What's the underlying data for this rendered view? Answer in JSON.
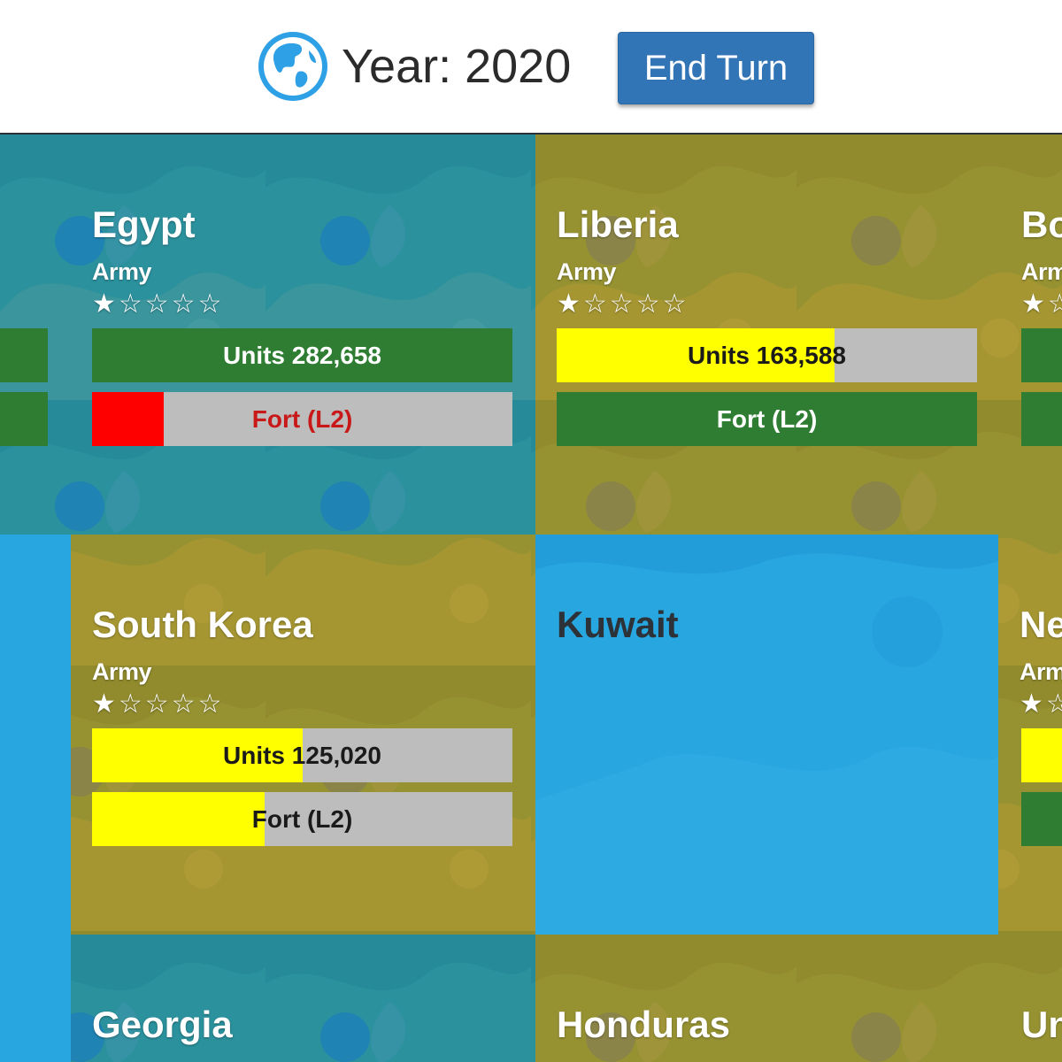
{
  "header": {
    "year_label": "Year: 2020",
    "end_turn_label": "End Turn",
    "icon": "globe-icon"
  },
  "colors": {
    "ocean_blue": "#1a8ad6",
    "land_orange": "#d68c12",
    "kuwait_blue": "#27a6e0",
    "bar_green": "#2e7d32",
    "bar_yellow": "#ffff00",
    "bar_red": "#ff0000",
    "bar_track": "#bdbdbd",
    "button_blue": "#3275b7"
  },
  "tiles": {
    "egypt": {
      "name": "Egypt",
      "army_label": "Army",
      "stars": "★☆☆☆☆",
      "units_label": "Units 282,658",
      "units_fill": 1.0,
      "fort_label": "Fort (L2)",
      "fort_fill": 0.17
    },
    "liberia": {
      "name": "Liberia",
      "army_label": "Army",
      "stars": "★☆☆☆☆",
      "units_label": "Units 163,588",
      "units_fill": 0.66,
      "fort_label": "Fort (L2)",
      "fort_fill": 1.0
    },
    "bo_partial": {
      "name": "Bo",
      "army_label": "Arm",
      "stars": "★☆"
    },
    "south_korea": {
      "name": "South Korea",
      "army_label": "Army",
      "stars": "★☆☆☆☆",
      "units_label": "Units 125,020",
      "units_fill": 0.5,
      "fort_label": "Fort (L2)",
      "fort_fill": 0.41
    },
    "kuwait": {
      "name": "Kuwait"
    },
    "ne_partial": {
      "name": "Ne",
      "army_label": "Arm",
      "stars": "★☆"
    },
    "georgia": {
      "name": "Georgia"
    },
    "honduras": {
      "name": "Honduras"
    },
    "un_partial": {
      "name": "Un"
    }
  }
}
